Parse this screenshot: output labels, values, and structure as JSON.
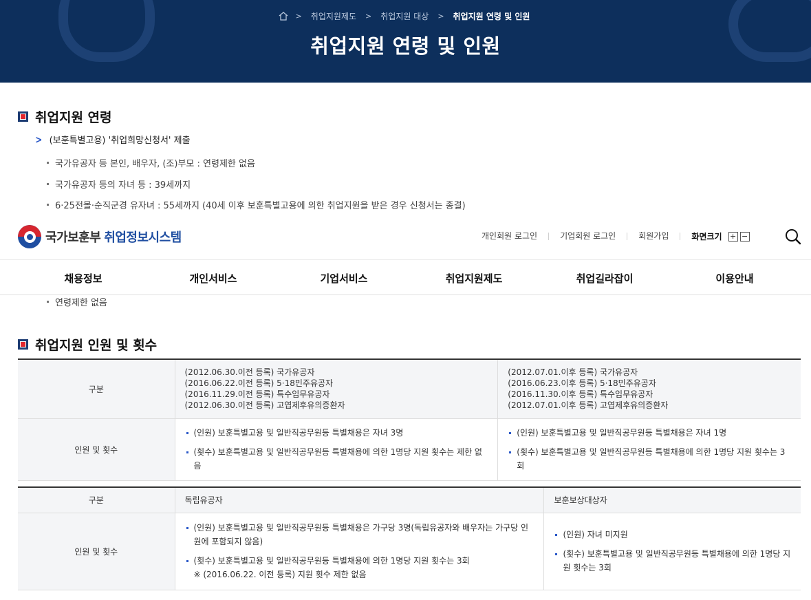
{
  "breadcrumb": [
    "취업지원제도",
    "취업지원 대상",
    "취업지원 연령 및 인원"
  ],
  "page_title": "취업지원 연령 및 인원",
  "section_age": {
    "title": "취업지원 연령",
    "arrow_item": "(보훈특별고용) '취업희망신청서' 제출",
    "bullets": [
      "국가유공자 등 본인, 배우자, (조)부모 : 연령제한 없음",
      "국가유공자 등의 자녀 등 : 39세까지",
      "6·25전몰·순직군경 유자녀 : 55세까지 (40세 이후 보훈특별고용에 의한 취업지원을 받은 경우 신청서는 종결)",
      "연령제한 없음"
    ]
  },
  "header": {
    "logo_org": "국가보훈부",
    "logo_system": "취업정보시스템",
    "util_links": [
      "개인회원 로그인",
      "기업회원 로그인",
      "회원가입"
    ],
    "font_size_label": "화면크기",
    "font_plus": "+",
    "font_minus": "−",
    "menu": [
      "채용정보",
      "개인서비스",
      "기업서비스",
      "취업지원제도",
      "취업길라잡이",
      "이용안내"
    ]
  },
  "section_count": {
    "title": "취업지원 인원 및 횟수",
    "table1": {
      "header_label": "구분",
      "col_a_lines": [
        "(2012.06.30.이전 등록) 국가유공자",
        "(2016.06.22.이전 등록) 5·18민주유공자",
        "(2016.11.29.이전 등록) 특수임무유공자",
        "(2012.06.30.이전 등록) 고엽제후유의증환자"
      ],
      "col_b_lines": [
        "(2012.07.01.이후 등록) 국가유공자",
        "(2016.06.23.이후 등록) 5·18민주유공자",
        "(2016.11.30.이후 등록) 특수임무유공자",
        "(2012.07.01.이후 등록) 고엽제후유의증환자"
      ],
      "row_label": "인원 및 횟수",
      "col_a_items": [
        "(인원) 보훈특별고용 및 일반직공무원등 특별채용은 자녀 3명",
        "(횟수) 보훈특별고용 및 일반직공무원등 특별채용에 의한 1명당 지원 횟수는 제한 없음"
      ],
      "col_b_items": [
        "(인원) 보훈특별고용 및 일반직공무원등 특별채용은 자녀 1명",
        "(횟수) 보훈특별고용 및 일반직공무원등 특별채용에 의한 1명당 지원 횟수는 3회"
      ]
    },
    "table2": {
      "header_label": "구분",
      "col_a_title": "독립유공자",
      "col_b_title": "보훈보상대상자",
      "row_label": "인원 및 횟수",
      "col_a_items": [
        "(인원) 보훈특별고용 및 일반직공무원등 특별채용은 가구당 3명(독립유공자와 배우자는 가구당 인원에 포함되지 않음)",
        "(횟수) 보훈특별고용 및 일반직공무원등 특별채용에 의한 1명당 지원 횟수는 3회"
      ],
      "col_a_note": "※ (2016.06.22. 이전 등록) 지원 횟수 제한 없음",
      "col_b_items": [
        "(인원) 자녀 미지원",
        "(횟수) 보훈특별고용 및 일반직공무원등 특별채용에 의한 1명당 지원 횟수는 3회"
      ]
    }
  },
  "colors": {
    "hero_bg": "#0d2f5c",
    "accent_blue": "#1f4ea1",
    "accent_red": "#e1262d"
  },
  "icons": {
    "home": "home-icon",
    "search": "search-icon",
    "section": "section-square-icon",
    "arrow": "chevron-right-icon"
  }
}
